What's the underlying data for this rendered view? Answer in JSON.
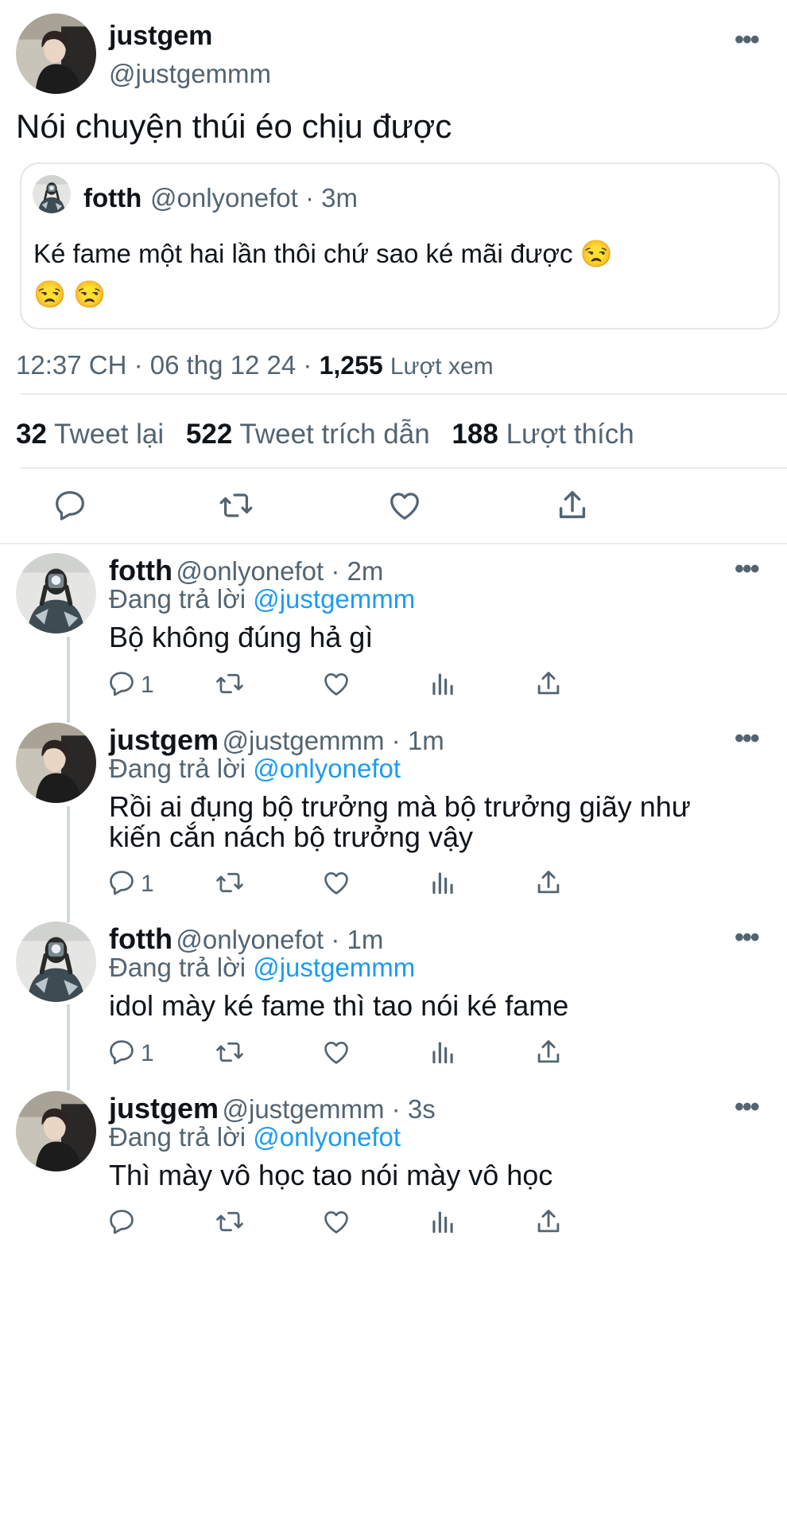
{
  "main": {
    "author_name": "justgem",
    "author_handle": "@justgemmm",
    "text": "Nói chuyện thúi éo chịu được",
    "quote": {
      "name": "fotth",
      "handle_time": "@onlyonefot · 3m",
      "text_line1": "Ké fame một hai lần thôi chứ sao ké mãi được 😒",
      "text_line2": "😒 😒"
    },
    "time_date": "12:37 CH · 06 thg 12 24 ·",
    "views_count": "1,255",
    "views_label": "Lượt xem",
    "stats": {
      "retweets_count": "32",
      "retweets_label": "Tweet lại",
      "quotes_count": "522",
      "quotes_label": "Tweet trích dẫn",
      "likes_count": "188",
      "likes_label": "Lượt thích"
    }
  },
  "replies": [
    {
      "name": "fotth",
      "meta": "@onlyonefot · 2m",
      "replying_label": "Đang trả lời",
      "replying_to": "@justgemmm",
      "text": "Bộ không đúng hả gì",
      "reply_count": "1"
    },
    {
      "name": "justgem",
      "meta": "@justgemmm · 1m",
      "replying_label": "Đang trả lời",
      "replying_to": "@onlyonefot",
      "text_line1": "Rồi ai đụng bộ trưởng mà bộ trưởng giãy như",
      "text_line2": "kiến cắn nách bộ trưởng vậy",
      "reply_count": "1"
    },
    {
      "name": "fotth",
      "meta": "@onlyonefot · 1m",
      "replying_label": "Đang trả lời",
      "replying_to": "@justgemmm",
      "text": "idol mày ké fame thì tao nói ké fame",
      "reply_count": "1"
    },
    {
      "name": "justgem",
      "meta": "@justgemmm · 3s",
      "replying_label": "Đang trả lời",
      "replying_to": "@onlyonefot",
      "text": "Thì mày vô học tao nói mày vô học",
      "reply_count": ""
    }
  ],
  "icons": {
    "more": "more-dots-icon",
    "reply": "reply-icon",
    "retweet": "retweet-icon",
    "like": "like-icon",
    "views": "views-icon",
    "share": "share-icon"
  }
}
